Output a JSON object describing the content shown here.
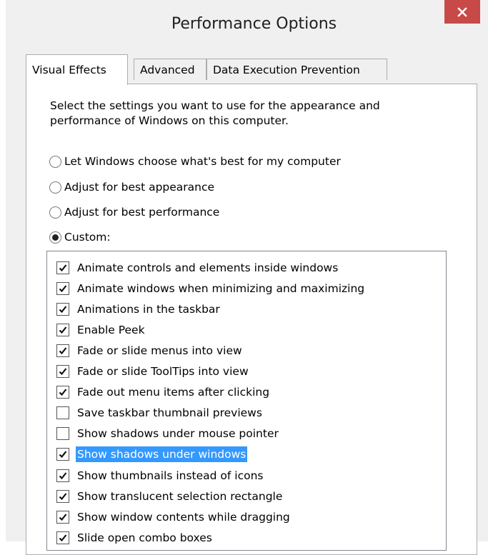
{
  "window": {
    "title": "Performance Options",
    "close_symbol": "✕"
  },
  "tabs": [
    {
      "label": "Visual Effects",
      "active": true
    },
    {
      "label": "Advanced",
      "active": false
    },
    {
      "label": "Data Execution Prevention",
      "active": false
    }
  ],
  "intro_text": "Select the settings you want to use for the appearance and performance of Windows on this computer.",
  "radio_options": [
    {
      "label": "Let Windows choose what's best for my computer",
      "checked": false
    },
    {
      "label": "Adjust for best appearance",
      "checked": false
    },
    {
      "label": "Adjust for best performance",
      "checked": false
    },
    {
      "label": "Custom:",
      "checked": true
    }
  ],
  "effects": [
    {
      "label": "Animate controls and elements inside windows",
      "checked": true
    },
    {
      "label": "Animate windows when minimizing and maximizing",
      "checked": true
    },
    {
      "label": "Animations in the taskbar",
      "checked": true
    },
    {
      "label": "Enable Peek",
      "checked": true
    },
    {
      "label": "Fade or slide menus into view",
      "checked": true
    },
    {
      "label": "Fade or slide ToolTips into view",
      "checked": true
    },
    {
      "label": "Fade out menu items after clicking",
      "checked": true
    },
    {
      "label": "Save taskbar thumbnail previews",
      "checked": false
    },
    {
      "label": "Show shadows under mouse pointer",
      "checked": false
    },
    {
      "label": "Show shadows under windows",
      "checked": true,
      "selected": true
    },
    {
      "label": "Show thumbnails instead of icons",
      "checked": true
    },
    {
      "label": "Show translucent selection rectangle",
      "checked": true
    },
    {
      "label": "Show window contents while dragging",
      "checked": true
    },
    {
      "label": "Slide open combo boxes",
      "checked": true
    }
  ],
  "colors": {
    "close_button": "#c74a48",
    "selection": "#3399ff",
    "window_bg": "#f0f0f0"
  }
}
